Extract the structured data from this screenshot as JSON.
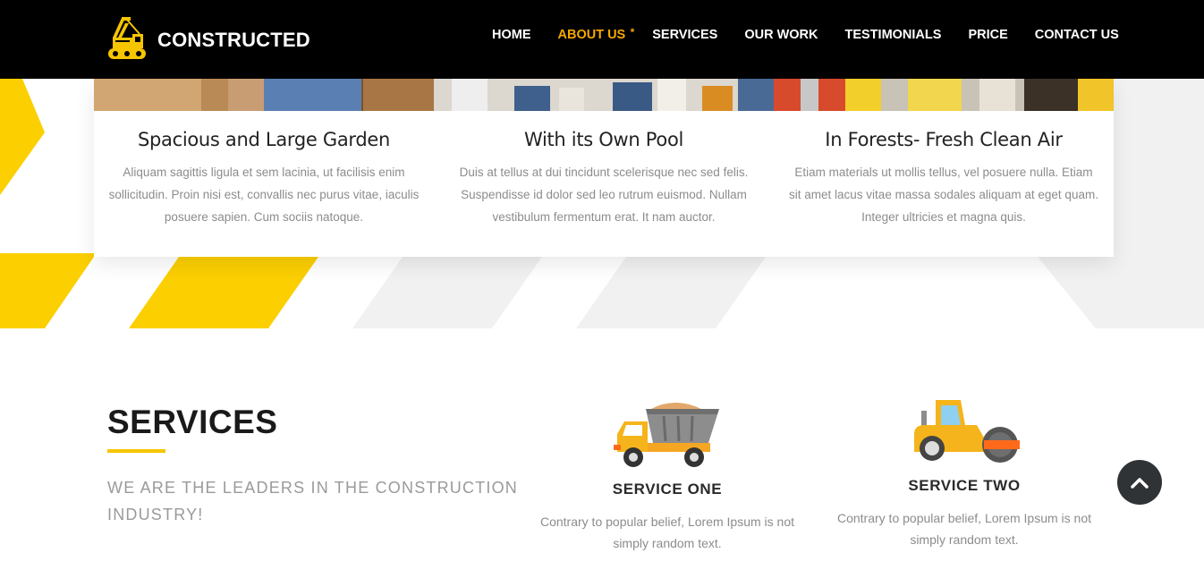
{
  "header": {
    "brand": "CONSTRUCTED",
    "nav": [
      {
        "label": "HOME"
      },
      {
        "label": "ABOUT US",
        "active": true
      },
      {
        "label": "SERVICES"
      },
      {
        "label": "OUR WORK"
      },
      {
        "label": "TESTIMONIALS"
      },
      {
        "label": "PRICE"
      },
      {
        "label": "CONTACT US"
      }
    ],
    "active_marker": "*"
  },
  "features": [
    {
      "title": "Spacious and Large Garden",
      "text": "Aliquam sagittis ligula et sem lacinia, ut facilisis enim sollicitudin. Proin nisi est, convallis nec purus vitae, iaculis posuere sapien. Cum sociis natoque."
    },
    {
      "title": "With its Own Pool",
      "text": "Duis at tellus at dui tincidunt scelerisque nec sed felis. Suspendisse id dolor sed leo rutrum euismod. Nullam vestibulum fermentum erat. It nam auctor."
    },
    {
      "title": "In Forests- Fresh Clean Air",
      "text": "Etiam materials ut mollis tellus, vel posuere nulla. Etiam sit amet lacus vitae massa sodales aliquam at eget quam. Integer ultricies et magna quis."
    }
  ],
  "services": {
    "title": "SERVICES",
    "subtitle": "WE ARE THE LEADERS IN THE CONSTRUCTION INDUSTRY!",
    "items": [
      {
        "name": "SERVICE ONE",
        "text": "Contrary to popular belief, Lorem Ipsum is not simply random text.",
        "icon": "dump-truck-icon"
      },
      {
        "name": "SERVICE TWO",
        "text": "Contrary to popular belief, Lorem Ipsum is not simply random text.",
        "icon": "road-roller-icon"
      }
    ]
  },
  "colors": {
    "accent": "#f6c500",
    "nav_active": "#f6a800",
    "header_bg": "#000000",
    "back_to_top_bg": "#2f3336"
  },
  "icons": [
    "crane-logo-icon",
    "chevron-up-icon"
  ]
}
